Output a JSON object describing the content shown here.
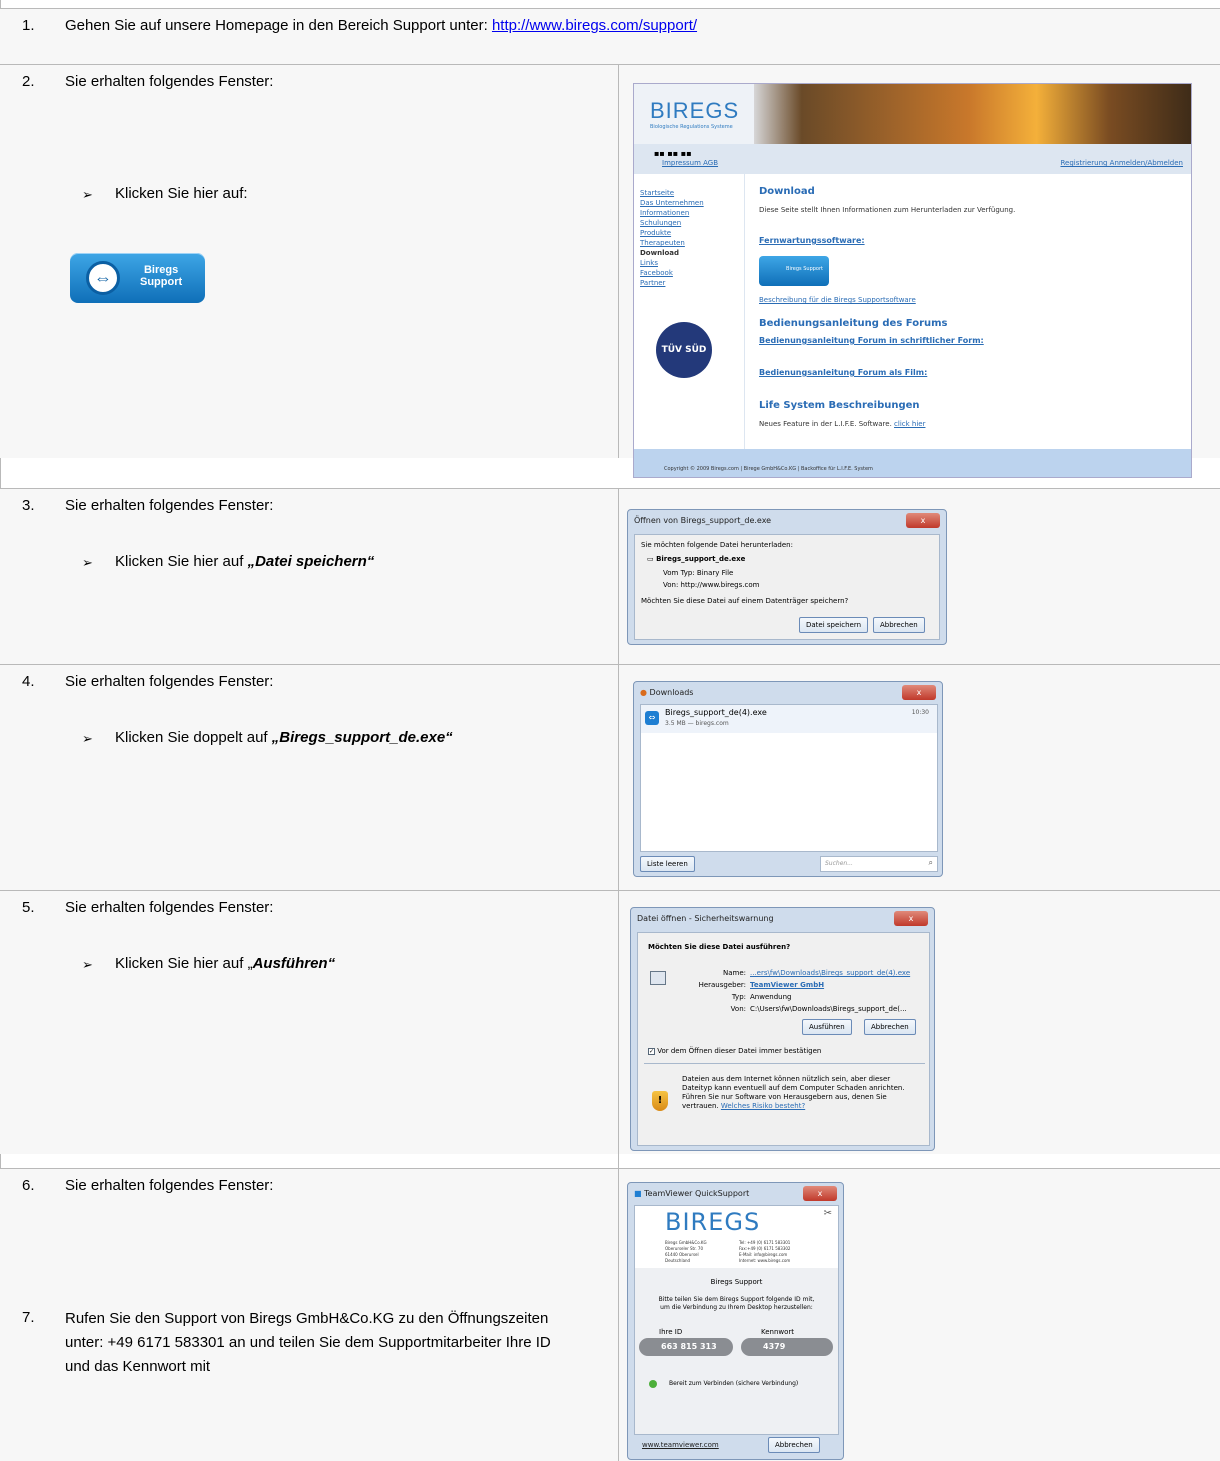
{
  "steps": [
    {
      "num": "1.",
      "text": "Gehen Sie auf unsere Homepage in den Bereich Support unter: ",
      "link": "http://www.biregs.com/support/"
    },
    {
      "num": "2.",
      "text": "Sie erhalten folgendes Fenster:",
      "bullet": "Klicken Sie hier auf:",
      "icon_label": "Biregs\nSupport"
    },
    {
      "num": "3.",
      "text": "Sie erhalten folgendes Fenster:",
      "bullet_prefix": "Klicken Sie hier auf ",
      "bullet_em": "„Datei speichern“"
    },
    {
      "num": "4.",
      "text": "Sie erhalten folgendes Fenster:",
      "bullet_prefix": "Klicken Sie doppelt auf ",
      "bullet_em": "„Biregs_support_de.exe“"
    },
    {
      "num": "5.",
      "text": "Sie erhalten folgendes Fenster:",
      "bullet_prefix": "Klicken Sie hier auf „",
      "bullet_em": "Ausführen“"
    },
    {
      "num": "6.",
      "text": "Sie erhalten folgendes Fenster:"
    },
    {
      "num": "7.",
      "text": "Rufen Sie den Support von Biregs GmbH&Co.KG zu den Öffnungszeiten unter: +49 6171 583301 an und teilen Sie dem Supportmitarbeiter Ihre ID und das Kennwort mit"
    }
  ],
  "bullet_glyph": "➢",
  "website": {
    "logo": "BIREGS",
    "logo_sub": "Biologische Regulations Systeme",
    "top_links": "Impressum  AGB",
    "top_right": "Registrierung   Anmelden/Abmelden",
    "nav": [
      "Startseite",
      "Das Unternehmen",
      "Informationen",
      "Schulungen",
      "Produkte",
      "Therapeuten",
      "Download",
      "Links",
      "Facebook",
      "Partner"
    ],
    "h_download": "Download",
    "desc": "Diese Seite stellt Ihnen Informationen zum Herunterladen zur Verfügung.",
    "h_fern": "Fernwartungssoftware:",
    "btn": "Biregs Support",
    "besch": "Beschreibung für die Biregs Supportsoftware",
    "h_forum": "Bedienungsanleitung des Forums",
    "forum1": "Bedienungsanleitung Forum in schriftlicher Form:",
    "forum2": "Bedienungsanleitung Forum als Film:",
    "h_life": "Life System Beschreibungen",
    "life": "Neues Feature in der L.I.F.E. Software.",
    "life_link": "click hier",
    "tuv": "TÜV SÜD",
    "footer": "Copyright © 2009 Biregs.com | Birege GmbH&Co.KG | Backoffice für L.I.F.E. System"
  },
  "dlg_open": {
    "title": "Öffnen von Biregs_support_de.exe",
    "q": "Sie möchten folgende Datei herunterladen:",
    "file": "Biregs_support_de.exe",
    "type": "Vom Typ:  Binary File",
    "from": "Von:  http://www.biregs.com",
    "ask": "Möchten Sie diese Datei auf einem Datenträger speichern?",
    "save": "Datei speichern",
    "cancel": "Abbrechen"
  },
  "dlg_downloads": {
    "title": "Downloads",
    "file": "Biregs_support_de(4).exe",
    "meta": "3.5 MB — biregs.com",
    "time": "10:30",
    "clear": "Liste leeren",
    "search": "Suchen..."
  },
  "dlg_security": {
    "title": "Datei öffnen - Sicherheitswarnung",
    "q": "Möchten Sie diese Datei ausführen?",
    "name_l": "Name:",
    "name_v": "...ers\\fw\\Downloads\\Biregs_support_de(4).exe",
    "pub_l": "Herausgeber:",
    "pub_v": "TeamViewer GmbH",
    "type_l": "Typ:",
    "type_v": "Anwendung",
    "from_l": "Von:",
    "from_v": "C:\\Users\\fw\\Downloads\\Biregs_support_de(...",
    "run": "Ausführen",
    "cancel": "Abbrechen",
    "check": "Vor dem Öffnen dieser Datei immer bestätigen",
    "warn": "Dateien aus dem Internet können nützlich sein, aber dieser Dateityp kann eventuell auf dem Computer Schaden anrichten. Führen Sie nur Software von Herausgebern aus, denen Sie vertrauen.",
    "warn_link": "Welches Risiko besteht?"
  },
  "dlg_tv": {
    "title": "TeamViewer QuickSupport",
    "logo": "BIREGS",
    "addr_left": "Biregs GmbH&Co.KG\nOberurseler Str. 70\n61440 Oberursel\nDeutschland",
    "addr_right": "Tel: +49 (0) 6171 583301\nFax:+49 (0) 6171 583302\nE-Mail: info@biregs.com\nInternet: www.biregs.com",
    "support": "Biregs Support",
    "msg": "Bitte teilen Sie dem Biregs Support folgende ID mit, um die Verbindung zu Ihrem Desktop herzustellen:",
    "id_l": "Ihre ID",
    "id_v": "663 815 313",
    "pw_l": "Kennwort",
    "pw_v": "4379",
    "status": "Bereit zum Verbinden (sichere Verbindung)",
    "link": "www.teamviewer.com",
    "cancel": "Abbrechen"
  }
}
